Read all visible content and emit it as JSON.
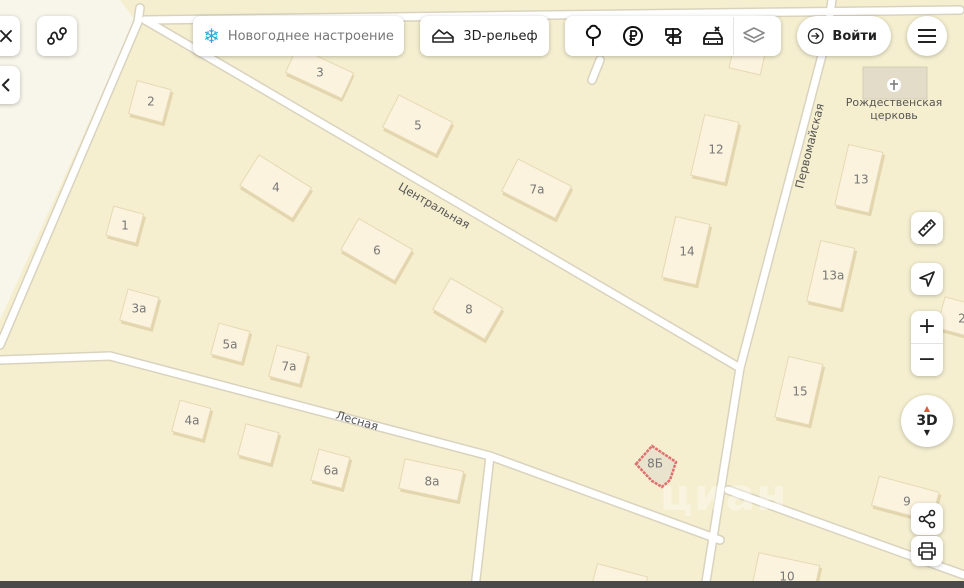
{
  "toolbar": {
    "close_label": "×",
    "route_icon": "route-icon",
    "new_year_label": "Новогоднее настроение",
    "relief_label": "3D-рельеф",
    "login_label": "Войти",
    "layers": [
      "tree-icon",
      "ruble-icon",
      "signpost-icon",
      "car-repair-icon",
      "layers-icon"
    ]
  },
  "map": {
    "streets": [
      "Центральная",
      "Лесная",
      "Первомайская"
    ],
    "poi": {
      "name_line1": "Рождественская",
      "name_line2": "церковь"
    },
    "buildings": [
      "3",
      "2",
      "5",
      "7а",
      "4",
      "12",
      "13",
      "1",
      "6",
      "14",
      "13а",
      "3а",
      "8",
      "5а",
      "7а",
      "15",
      "4а",
      "6а",
      "8а",
      "8Б",
      "9",
      "10",
      "2"
    ],
    "selected_building": "8Б",
    "watermark": "циан"
  },
  "controls": {
    "compass_label": "3D",
    "zoom_in": "+",
    "zoom_out": "−"
  },
  "colors": {
    "land": "#f5efd0",
    "road": "#ffffff",
    "building": "#fbf3de",
    "selected_outline": "#e06f6f",
    "left_strip": "#f7f3e6"
  }
}
